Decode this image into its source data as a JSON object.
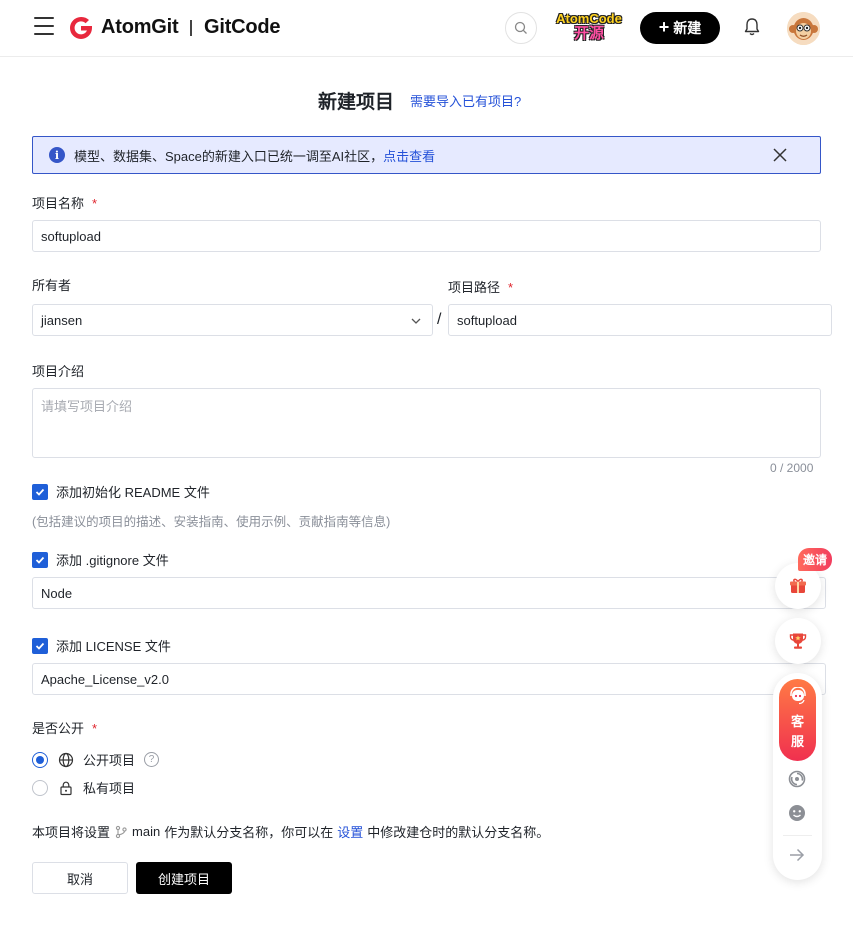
{
  "header": {
    "brand_left": "AtomGit",
    "brand_right": "GitCode",
    "atomcode_line1": "AtomCode",
    "atomcode_line2": "开源",
    "new_label": "新建"
  },
  "page": {
    "title": "新建项目",
    "import_link": "需要导入已有项目?"
  },
  "notice": {
    "text": "模型、数据集、Space的新建入口已统一调至AI社区，",
    "link": "点击查看"
  },
  "form": {
    "name_label": "项目名称",
    "required_mark": "*",
    "name_value": "softupload",
    "owner_label": "所有者",
    "owner_value": "jiansen",
    "path_label": "项目路径",
    "path_value": "softupload",
    "path_sep": "/",
    "intro_label": "项目介绍",
    "intro_placeholder": "请填写项目介绍",
    "intro_counter": "0 / 2000",
    "readme_label": "添加初始化 README 文件",
    "readme_hint": "(包括建议的项目的描述、安装指南、使用示例、贡献指南等信息)",
    "gitignore_label": "添加 .gitignore 文件",
    "gitignore_value": "Node",
    "license_label": "添加 LICENSE 文件",
    "license_value": "Apache_License_v2.0",
    "visibility_label": "是否公开",
    "public_label": "公开项目",
    "private_label": "私有项目",
    "help_mark": "?",
    "branch_prefix": "本项目将设置",
    "branch_name": "main",
    "branch_middle": "作为默认分支名称，你可以在",
    "branch_link": "设置",
    "branch_suffix": "中修改建仓时的默认分支名称。",
    "cancel_label": "取消",
    "create_label": "创建项目"
  },
  "floating": {
    "invite_label": "邀请",
    "service_label_1": "客",
    "service_label_2": "服"
  },
  "colors": {
    "accent": "#1f5fd8",
    "link": "#2451d8",
    "notice_bg": "#e6eaff",
    "required": "#e0242d",
    "brand_red": "#e8283d"
  }
}
